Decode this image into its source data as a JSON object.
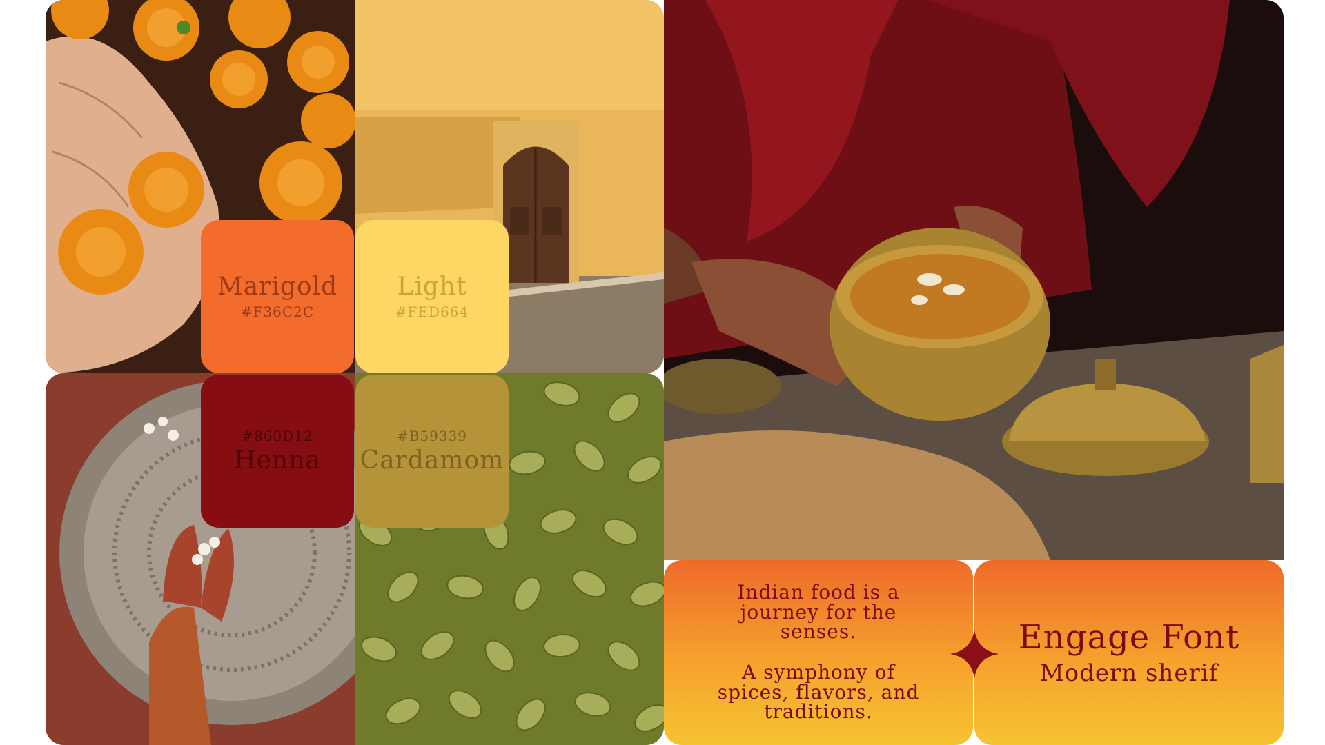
{
  "colors": {
    "marigold": "#F36C2C",
    "light": "#FED664",
    "henna": "#860D12",
    "cardamom": "#B59339",
    "card_gradient_top": "#EE6A2A",
    "card_gradient_bottom": "#F6C332",
    "text_dark_red": "#7A0C10"
  },
  "swatches": [
    {
      "name": "Marigold",
      "hex": "#F36C2C"
    },
    {
      "name": "Light",
      "hex": "#FED664"
    },
    {
      "name": "Henna",
      "hex": "#860D12"
    },
    {
      "name": "Cardamom",
      "hex": "#B59339"
    }
  ],
  "quote": {
    "line1": "Indian food is a",
    "line2": "journey for the",
    "line3": "senses.",
    "line4": "A symphony of",
    "line5": "spices, flavors, and",
    "line6": "traditions."
  },
  "font_card": {
    "name": "Engage Font",
    "type": "Modern sherif"
  },
  "icons": {
    "divider": "four-point-star-icon"
  }
}
